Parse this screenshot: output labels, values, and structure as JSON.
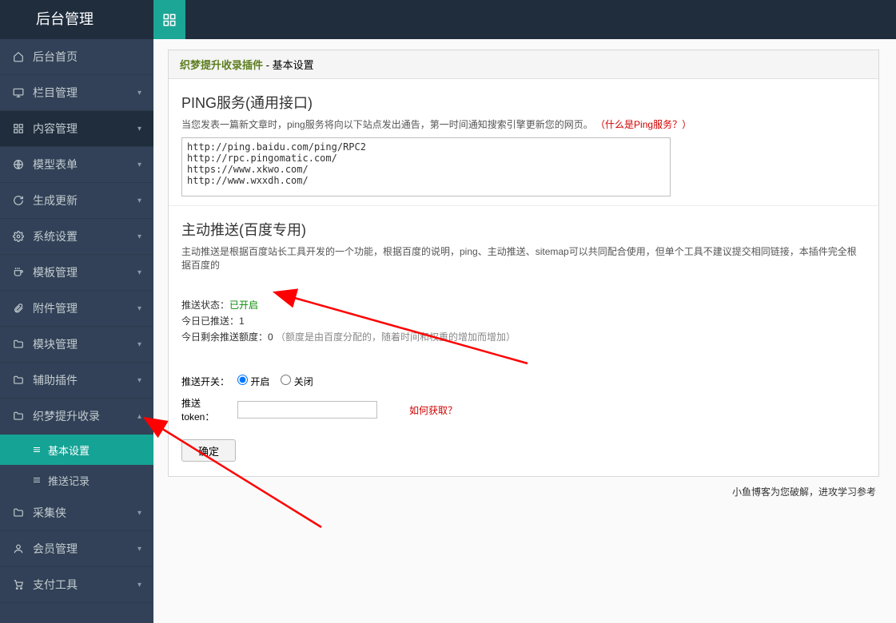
{
  "brand": "后台管理",
  "sidebar": [
    {
      "label": "后台首页",
      "icon": "home",
      "chevron": ""
    },
    {
      "label": "栏目管理",
      "icon": "desktop",
      "chevron": "▾"
    },
    {
      "label": "内容管理",
      "icon": "grid",
      "chevron": "▾",
      "active": true
    },
    {
      "label": "模型表单",
      "icon": "globe",
      "chevron": "▾"
    },
    {
      "label": "生成更新",
      "icon": "refresh",
      "chevron": "▾"
    },
    {
      "label": "系统设置",
      "icon": "gear",
      "chevron": "▾"
    },
    {
      "label": "模板管理",
      "icon": "cup",
      "chevron": "▾"
    },
    {
      "label": "附件管理",
      "icon": "clip",
      "chevron": "▾"
    },
    {
      "label": "模块管理",
      "icon": "folder",
      "chevron": "▾"
    },
    {
      "label": "辅助插件",
      "icon": "folder",
      "chevron": "▾"
    },
    {
      "label": "织梦提升收录",
      "icon": "folder",
      "chevron": "▴",
      "expanded": true,
      "children": [
        {
          "label": "基本设置",
          "active": true
        },
        {
          "label": "推送记录",
          "active": false
        }
      ]
    },
    {
      "label": "采集侠",
      "icon": "folder",
      "chevron": "▾"
    },
    {
      "label": "会员管理",
      "icon": "user",
      "chevron": "▾"
    },
    {
      "label": "支付工具",
      "icon": "cart",
      "chevron": "▾"
    }
  ],
  "crumb": {
    "a": "织梦提升收录插件",
    "sep": " - ",
    "b": "基本设置"
  },
  "section1": {
    "title": "PING服务(通用接口)",
    "desc": "当您发表一篇新文章时，ping服务将向以下站点发出通告，第一时间通知搜索引擎更新您的网页。",
    "link": "（什么是Ping服务？）",
    "textarea": "http://ping.baidu.com/ping/RPC2\nhttp://rpc.pingomatic.com/\nhttps://www.xkwo.com/\nhttp://www.wxxdh.com/"
  },
  "section2": {
    "title": "主动推送(百度专用)",
    "desc": "主动推送是根据百度站长工具开发的一个功能，根据百度的说明，ping、主动推送、sitemap可以共同配合使用，但单个工具不建议提交相同链接，本插件完全根据百度的",
    "status_label": "推送状态：",
    "status_value": "已开启",
    "today_label": "今日已推送：",
    "today_value": "1",
    "remain_label": "今日剩余推送额度：",
    "remain_value": "0",
    "remain_hint": "（额度是由百度分配的，随着时间和权重的增加而增加）",
    "switch_label": "推送开关：",
    "switch_on": "开启",
    "switch_off": "关闭",
    "token_label": "推送token：",
    "token_value": "",
    "token_link": "如何获取？",
    "confirm": "确定"
  },
  "footer": "小鱼博客为您破解，进攻学习参考"
}
